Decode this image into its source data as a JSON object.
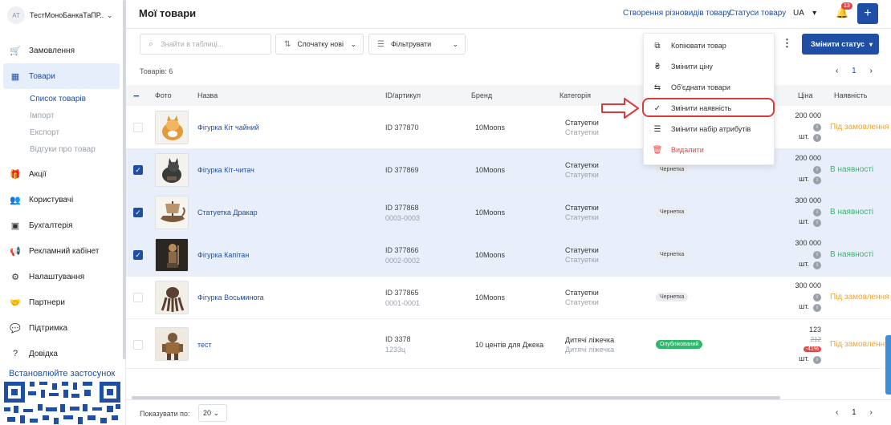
{
  "account": {
    "initials": "АТ",
    "name": "ТестМоноБанкаТаПР...",
    "chev": "⌄"
  },
  "sidebar": {
    "items": [
      {
        "label": "Замовлення",
        "icon": "cart-icon",
        "glyph": "🛒"
      },
      {
        "label": "Товари",
        "icon": "box-icon",
        "glyph": "▦"
      },
      {
        "label": "Акції",
        "icon": "gift-icon",
        "glyph": "🎁"
      },
      {
        "label": "Користувачі",
        "icon": "users-icon",
        "glyph": "👥"
      },
      {
        "label": "Бухгалтерія",
        "icon": "wallet-icon",
        "glyph": "▣"
      },
      {
        "label": "Рекламний кабінет",
        "icon": "megaphone-icon",
        "glyph": "📢"
      },
      {
        "label": "Налаштування",
        "icon": "gear-icon",
        "glyph": "⚙"
      },
      {
        "label": "Партнери",
        "icon": "handshake-icon",
        "glyph": "🤝"
      },
      {
        "label": "Підтримка",
        "icon": "chat-icon",
        "glyph": "💬"
      },
      {
        "label": "Довідка",
        "icon": "help-icon",
        "glyph": "?"
      }
    ],
    "subitems": [
      "Список товарів",
      "Імпорт",
      "Експорт",
      "Відгуки про товар"
    ],
    "install": "Встановлюйте застосунок"
  },
  "header": {
    "title": "Мої товари",
    "link_variants": "Створення різновидів товару",
    "link_statuses": "Статуси товару",
    "lang": "UA",
    "lang_chev": "▾",
    "bell_glyph": "🔔",
    "notifications": "13",
    "plus": "+"
  },
  "toolbar": {
    "search_placeholder": "Знайти в таблиці...",
    "search_glyph": "⌕",
    "sort_label": "Спочатку нові",
    "sort_glyph": "⇅",
    "filter_label": "Фільтрувати",
    "filter_glyph": "☰",
    "chev": "⌄",
    "kebab": "⋮",
    "status_label": "Змінити статус",
    "status_chev": "▾"
  },
  "count_label": "Товарів: 6",
  "pagination": {
    "prev": "‹",
    "page": "1",
    "next": "›"
  },
  "table": {
    "minus": "−",
    "headers": {
      "photo": "Фото",
      "name": "Назва",
      "id": "ID/артикул",
      "brand": "Бренд",
      "category": "Категорія",
      "price": "Ціна",
      "availability": "Наявність"
    },
    "rows": [
      {
        "name": "Фігурка Кіт чайний",
        "id": "ID 377870",
        "sku": "",
        "brand": "10Moons",
        "cat": "Статуетки",
        "cat_sub": "Статуетки",
        "status": "",
        "price": "200 000",
        "unit": "шт.",
        "avail": "Під замовлення",
        "selected": false
      },
      {
        "name": "Фігурка Кіт-читач",
        "id": "ID 377869",
        "sku": "",
        "brand": "10Moons",
        "cat": "Статуетки",
        "cat_sub": "Статуетки",
        "status": "Чернетка",
        "price": "200 000",
        "unit": "шт.",
        "avail": "В наявності",
        "selected": true
      },
      {
        "name": "Статуетка Дракар",
        "id": "ID 377868",
        "sku": "0003-0003",
        "brand": "10Moons",
        "cat": "Статуетки",
        "cat_sub": "Статуетки",
        "status": "Чернетка",
        "price": "300 000",
        "unit": "шт.",
        "avail": "В наявності",
        "selected": true
      },
      {
        "name": "Фігурка Капітан",
        "id": "ID 377866",
        "sku": "0002-0002",
        "brand": "10Moons",
        "cat": "Статуетки",
        "cat_sub": "Статуетки",
        "status": "Чернетка",
        "price": "300 000",
        "unit": "шт.",
        "avail": "В наявності",
        "selected": true
      },
      {
        "name": "Фігурка Восьминога",
        "id": "ID 377865",
        "sku": "0001-0001",
        "brand": "10Moons",
        "cat": "Статуетки",
        "cat_sub": "Статуетки",
        "status": "Чернетка",
        "price": "300 000",
        "unit": "шт.",
        "avail": "Під замовлення",
        "selected": false
      },
      {
        "name": "тест",
        "id": "ID 3378",
        "sku": "1233ц",
        "brand": "10 центів для Джека",
        "cat": "Дитячі ліжечка",
        "cat_sub": "Дитячі ліжечка",
        "status": "Опублікований",
        "price": "123",
        "old_price": "212",
        "discount": "-41%",
        "unit": "шт.",
        "avail": "Під замовлення",
        "selected": false
      }
    ]
  },
  "menu": {
    "items": [
      {
        "label": "Копіювати товар",
        "glyph": "⧉"
      },
      {
        "label": "Змінити ціну",
        "glyph": "₴"
      },
      {
        "label": "Об'єднати товари",
        "glyph": "⇆"
      },
      {
        "label": "Змінити наявність",
        "glyph": "✓"
      },
      {
        "label": "Змінити набір атрибутів",
        "glyph": "☰"
      },
      {
        "label": "Видалити",
        "glyph": "🗑"
      }
    ]
  },
  "footer": {
    "show_label": "Показувати по:",
    "page_size": "20 ⌄"
  },
  "info_glyph": "i",
  "check_glyph": "✓",
  "colors": {
    "accent": "#1f4fa5",
    "in_stock": "#2fb86b",
    "on_order": "#f0a431",
    "danger": "#e64646"
  }
}
